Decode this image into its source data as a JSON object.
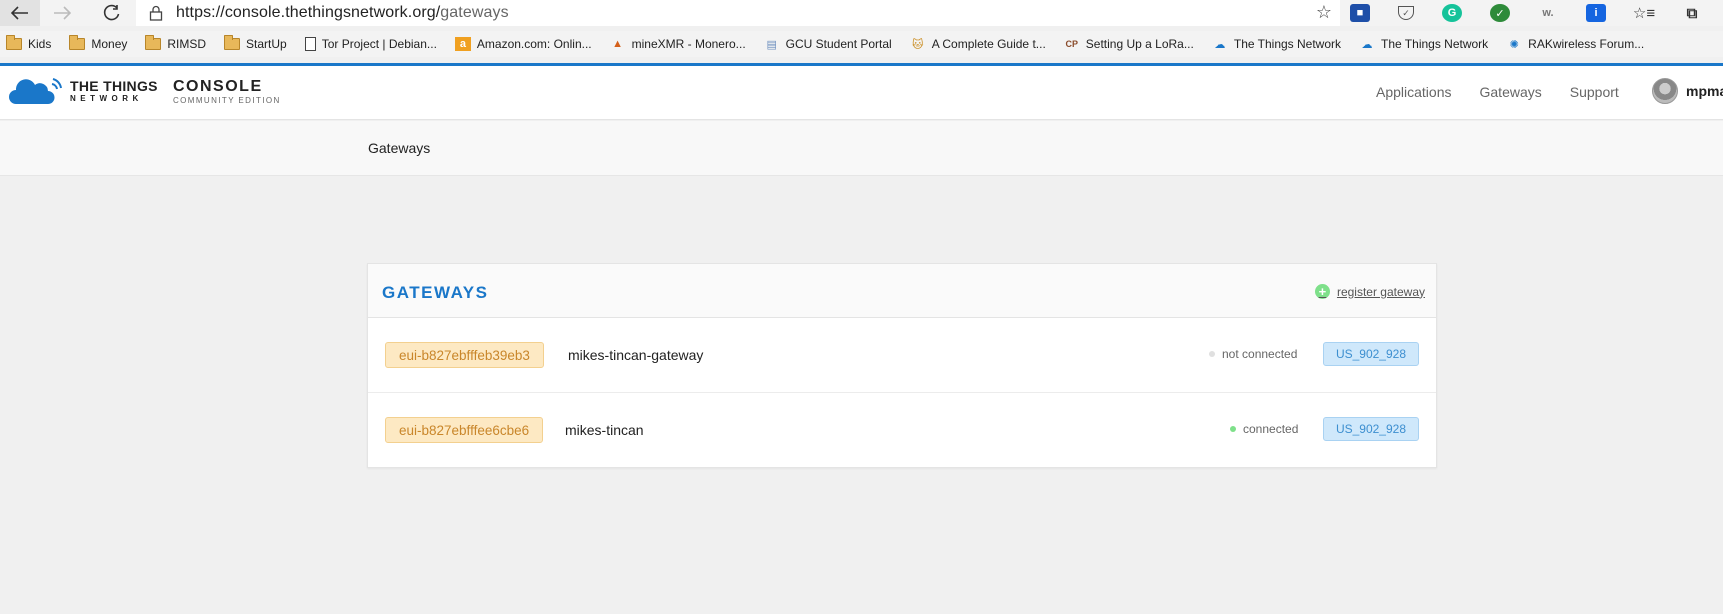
{
  "browser": {
    "url_base": "https://console.thethingsnetwork.org/",
    "url_path": "gateways",
    "bookmarks": [
      {
        "label": "Kids",
        "icon": "folder-icon"
      },
      {
        "label": "Money",
        "icon": "folder-icon"
      },
      {
        "label": "RIMSD",
        "icon": "folder-icon"
      },
      {
        "label": "StartUp",
        "icon": "folder-icon"
      },
      {
        "label": "Tor Project | Debian...",
        "icon": "page-icon"
      },
      {
        "label": "Amazon.com: Onlin...",
        "icon": "amazon-icon"
      },
      {
        "label": "mineXMR - Monero...",
        "icon": "mountain-icon"
      },
      {
        "label": "GCU Student Portal",
        "icon": "doc-icon"
      },
      {
        "label": "A Complete Guide t...",
        "icon": "cat-icon"
      },
      {
        "label": "Setting Up a LoRa...",
        "icon": "cp-icon"
      },
      {
        "label": "The Things Network",
        "icon": "ttn-icon"
      },
      {
        "label": "The Things Network",
        "icon": "ttn-icon"
      },
      {
        "label": "RAKwireless Forum...",
        "icon": "rak-icon"
      }
    ]
  },
  "header": {
    "logo_line1": "THE THINGS",
    "logo_line2": "NETWORK",
    "console_title": "CONSOLE",
    "console_subtitle": "COMMUNITY EDITION",
    "nav": [
      "Applications",
      "Gateways",
      "Support"
    ],
    "username": "mpma"
  },
  "breadcrumb": "Gateways",
  "gateways": {
    "title": "GATEWAYS",
    "register_label": "register gateway",
    "rows": [
      {
        "eui": "eui-b827ebfffeb39eb3",
        "name": "mikes-tincan-gateway",
        "status": "not connected",
        "frequency": "US_902_928"
      },
      {
        "eui": "eui-b827ebfffee6cbe6",
        "name": "mikes-tincan",
        "status": "connected",
        "frequency": "US_902_928"
      }
    ]
  },
  "colors": {
    "brand_blue": "#1a77c9",
    "connected_green": "#7ee08a",
    "not_connected_gray": "#e0e0e0"
  }
}
